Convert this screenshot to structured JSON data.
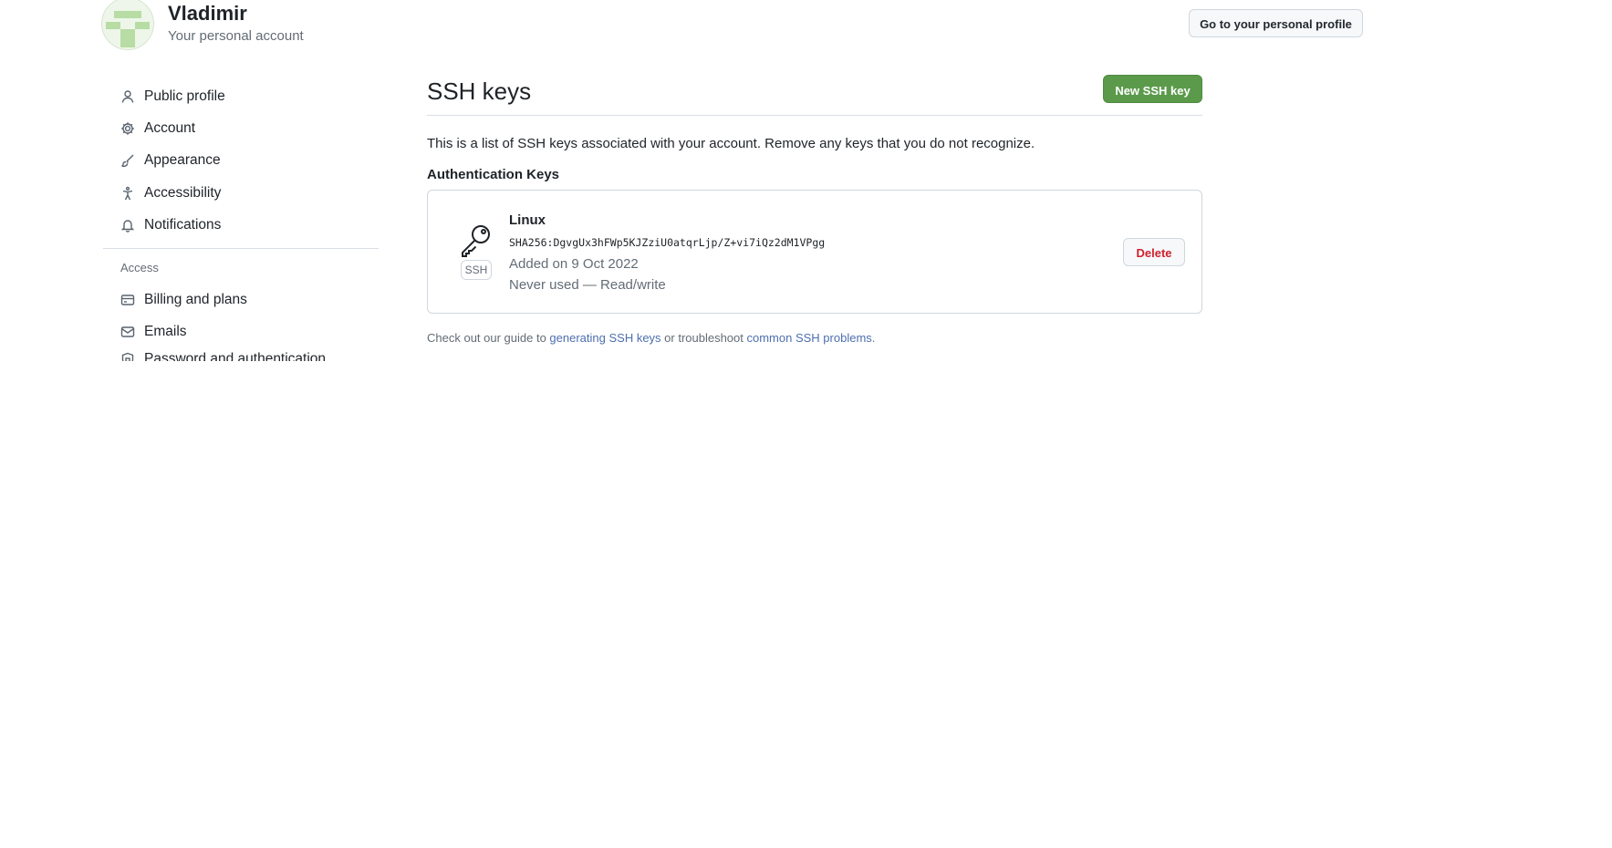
{
  "header": {
    "account_name": "Vladimir",
    "account_subtitle": "Your personal account",
    "profile_button": "Go to your personal profile"
  },
  "sidebar": {
    "items": [
      {
        "label": "Public profile",
        "icon": "person-icon"
      },
      {
        "label": "Account",
        "icon": "gear-icon"
      },
      {
        "label": "Appearance",
        "icon": "paintbrush-icon"
      },
      {
        "label": "Accessibility",
        "icon": "accessibility-icon"
      },
      {
        "label": "Notifications",
        "icon": "bell-icon"
      }
    ],
    "access_heading": "Access",
    "access_items": [
      {
        "label": "Billing and plans",
        "icon": "credit-card-icon"
      },
      {
        "label": "Emails",
        "icon": "mail-icon"
      },
      {
        "label": "Password and authentication",
        "icon": "shield-lock-icon"
      }
    ]
  },
  "main": {
    "title": "SSH keys",
    "new_key_button": "New SSH key",
    "intro": "This is a list of SSH keys associated with your account. Remove any keys that you do not recognize.",
    "section_heading": "Authentication Keys",
    "keys": [
      {
        "title": "Linux",
        "fingerprint": "SHA256:DgvgUx3hFWp5KJZziU0atqrLjp/Z+vi7iQz2dM1VPgg",
        "added": "Added on 9 Oct 2022",
        "usage": "Never used — Read/write",
        "type_badge": "SSH",
        "delete_label": "Delete",
        "icon": "key-icon"
      }
    ],
    "footer": {
      "prefix": "Check out our guide to ",
      "link1": "generating SSH keys",
      "middle": " or troubleshoot ",
      "link2": "common SSH problems",
      "suffix": "."
    }
  },
  "colors": {
    "primary_button": "#5c9a4b",
    "link": "#4d6fb0",
    "danger": "#cf222e",
    "avatar_accent": "#b7dca4"
  }
}
